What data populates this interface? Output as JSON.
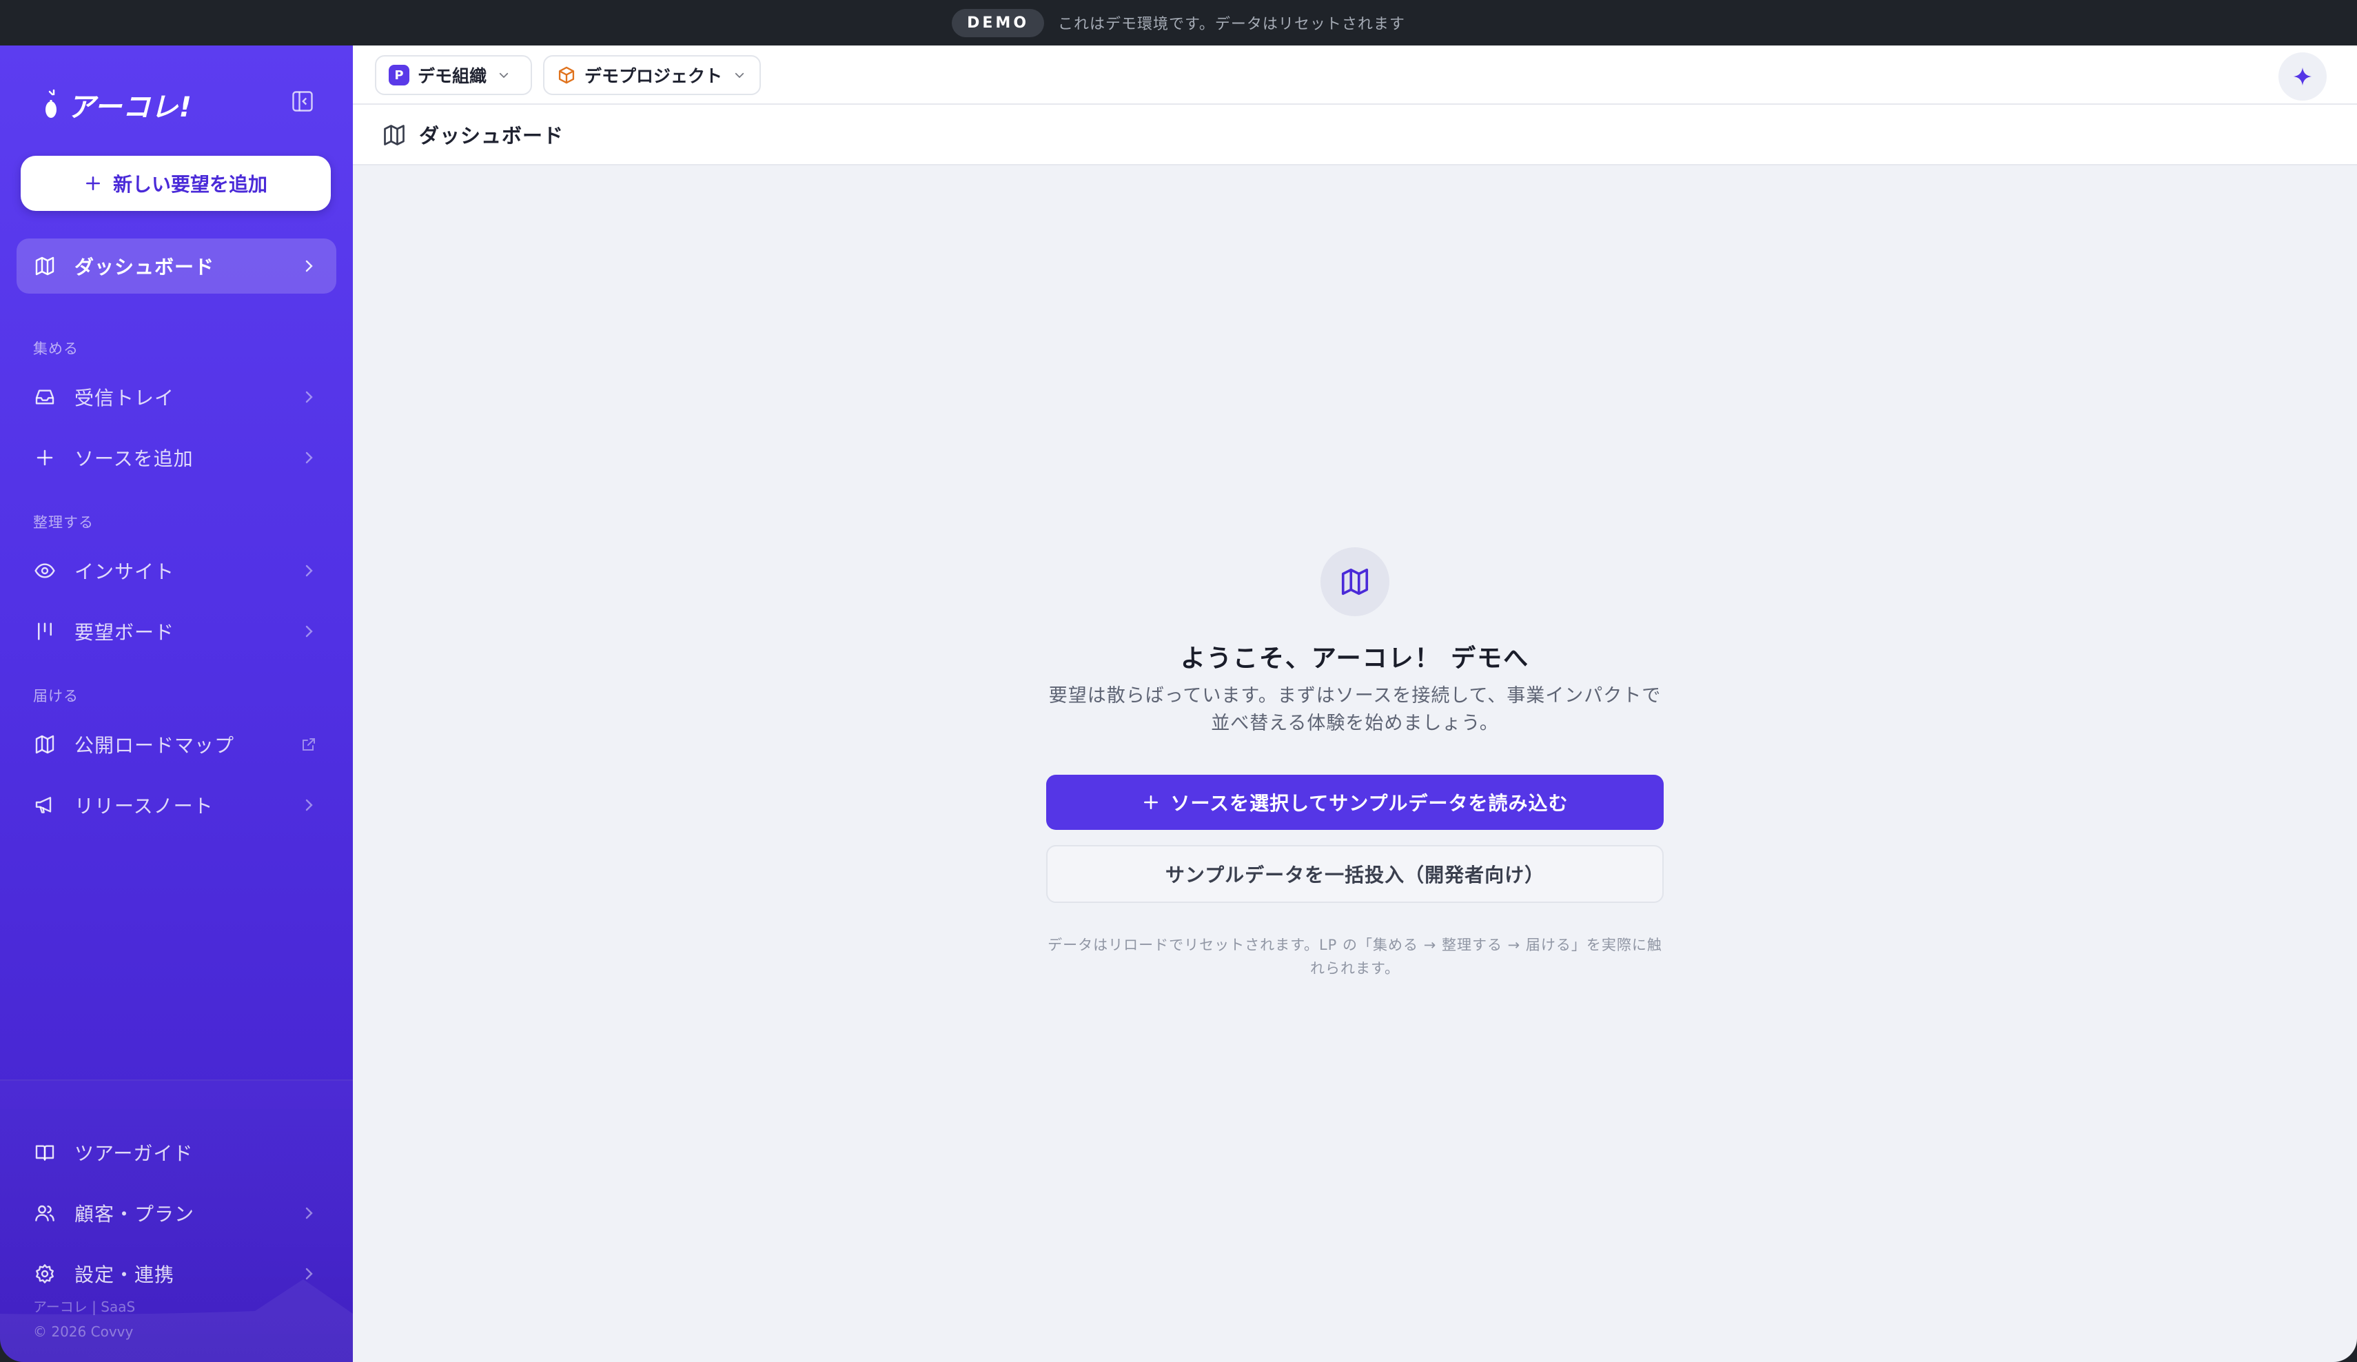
{
  "banner": {
    "badge": "DEMO",
    "message": "これはデモ環境です。データはリセットされます"
  },
  "sidebar": {
    "logo_text": "アーコレ!",
    "add_button_label": "新しい要望を追加",
    "dashboard_label": "ダッシュボード",
    "sections": [
      {
        "label": "集める",
        "items": [
          {
            "label": "受信トレイ",
            "icon": "inbox-icon"
          },
          {
            "label": "ソースを追加",
            "icon": "plus-icon"
          }
        ]
      },
      {
        "label": "整理する",
        "items": [
          {
            "label": "インサイト",
            "icon": "eye-icon"
          },
          {
            "label": "要望ボード",
            "icon": "board-icon"
          }
        ]
      },
      {
        "label": "届ける",
        "items": [
          {
            "label": "公開ロードマップ",
            "icon": "map-icon"
          },
          {
            "label": "リリースノート",
            "icon": "megaphone-icon"
          }
        ]
      }
    ],
    "bottom_items": [
      {
        "label": "ツアーガイド",
        "icon": "book-icon"
      },
      {
        "label": "顧客・プラン",
        "icon": "users-icon"
      },
      {
        "label": "設定・連携",
        "icon": "gear-icon"
      }
    ],
    "footer_line1": "アーコレ | SaaS",
    "footer_line2": "© 2026 Covvy"
  },
  "topbar": {
    "org_badge": "P",
    "org_name": "デモ組織",
    "project_name": "デモプロジェクト"
  },
  "page": {
    "title": "ダッシュボード"
  },
  "empty_state": {
    "title": "ようこそ、アーコレ！ デモへ",
    "description_line1": "要望は散らばっています。まずはソースを接続して、事業インパクトで",
    "description_line2": "並べ替える体験を始めましょう。",
    "primary_button": "ソースを選択してサンプルデータを読み込む",
    "secondary_button": "サンプルデータを一括投入（開発者向け）",
    "note_line1": "データはリロードでリセットされます。LP の「集める → 整理する → 届ける」を実際に触",
    "note_line2": "れられます。"
  },
  "colors": {
    "accent": "#5536e6",
    "sidebar_top": "#5c3df0",
    "sidebar_bottom": "#4321c9",
    "background": "#f0f2f7"
  }
}
